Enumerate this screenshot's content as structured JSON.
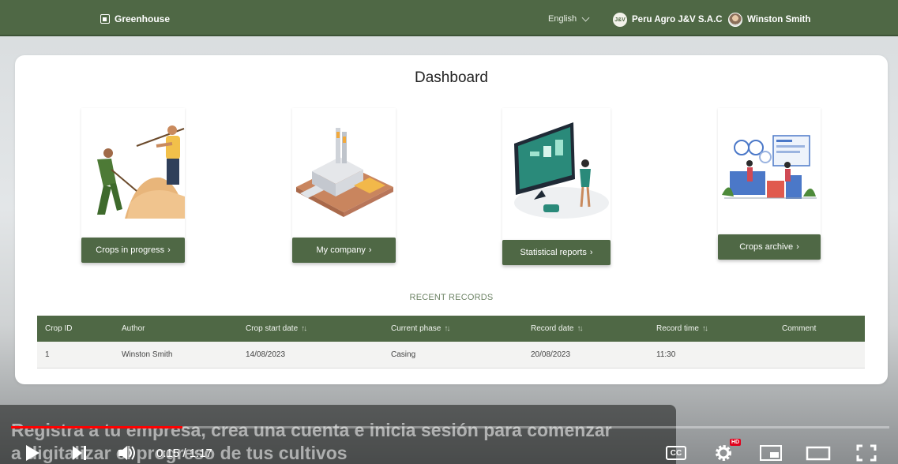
{
  "nav": {
    "brand": "Greenhouse",
    "language": "English",
    "company": "Peru Agro J&V S.A.C",
    "company_logo_text": "J&V",
    "user": "Winston Smith"
  },
  "dashboard": {
    "title": "Dashboard",
    "tiles": [
      {
        "label": "Crops in progress",
        "icon": "farmers-illustration"
      },
      {
        "label": "My company",
        "icon": "factory-illustration"
      },
      {
        "label": "Statistical reports",
        "icon": "statistics-illustration"
      },
      {
        "label": "Crops archive",
        "icon": "archive-illustration"
      }
    ],
    "chevron": "›"
  },
  "recent": {
    "title": "RECENT RECORDS",
    "columns": [
      "Crop ID",
      "Author",
      "Crop start date",
      "Current phase",
      "Record date",
      "Record time",
      "Comment"
    ],
    "sortable": [
      false,
      false,
      true,
      true,
      true,
      true,
      false
    ],
    "rows": [
      [
        "1",
        "Winston Smith",
        "14/08/2023",
        "Casing",
        "20/08/2023",
        "11:30",
        ""
      ]
    ]
  },
  "video": {
    "subtitle_line1": "Registra a tu empresa, crea una cuenta e inicia sesión para comenzar",
    "subtitle_line2": "a digitalizar el progreso de tus cultivos",
    "time": "0:15 / 1:17",
    "progress": 0.195,
    "cc": "CC",
    "hd": "HD"
  },
  "colors": {
    "brand_green": "#4f6845",
    "accent_red": "#ff0000"
  }
}
